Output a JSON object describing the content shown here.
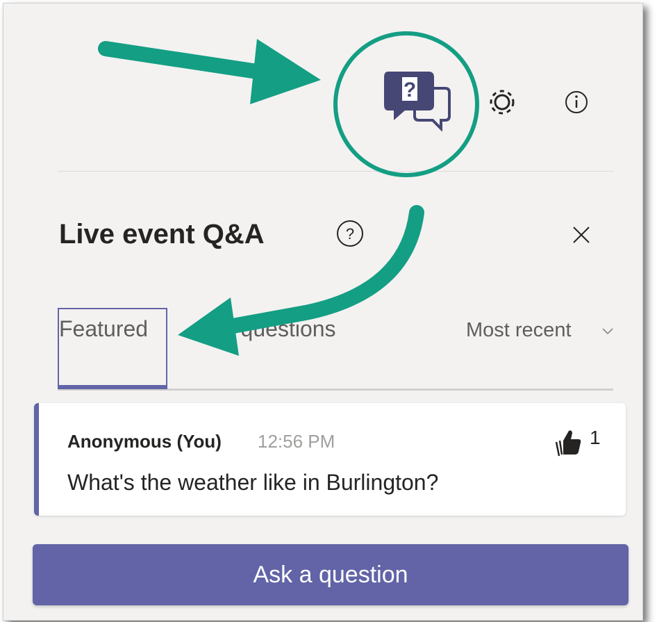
{
  "panel": {
    "title": "Live event Q&A",
    "toolbar": {
      "qa_icon": "qa-chat-icon",
      "settings_icon": "gear-icon",
      "info_icon": "info-icon"
    },
    "tabs": [
      {
        "label": "Featured",
        "selected": true
      },
      {
        "label": "My questions",
        "selected": false
      }
    ],
    "sort": {
      "label": "Most recent"
    },
    "questions": [
      {
        "author": "Anonymous (You)",
        "time": "12:56 PM",
        "text": "What's the weather like in Burlington?",
        "likes": "1"
      }
    ],
    "ask_button": "Ask a question"
  },
  "colors": {
    "accent": "#6264a7",
    "highlight": "#149e84",
    "panel_bg": "#f3f2f1"
  }
}
